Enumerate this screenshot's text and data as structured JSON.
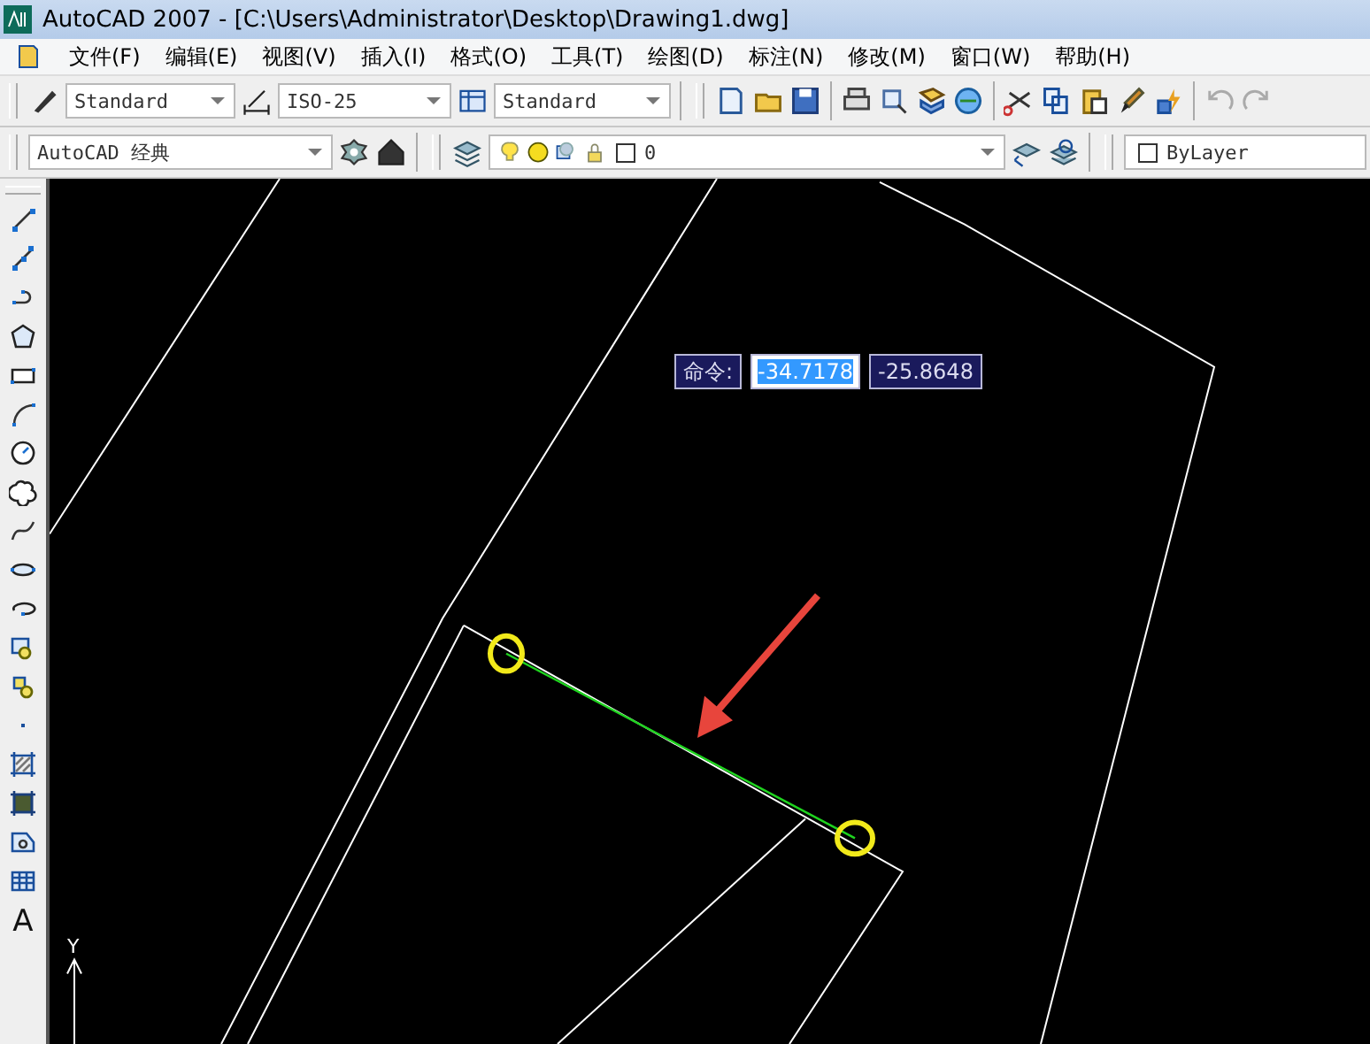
{
  "window": {
    "title": "AutoCAD 2007 - [C:\\Users\\Administrator\\Desktop\\Drawing1.dwg]"
  },
  "menu": [
    "文件(F)",
    "编辑(E)",
    "视图(V)",
    "插入(I)",
    "格式(O)",
    "工具(T)",
    "绘图(D)",
    "标注(N)",
    "修改(M)",
    "窗口(W)",
    "帮助(H)"
  ],
  "styles_toolbar": {
    "text_style": "Standard",
    "dim_style": "ISO-25",
    "table_style": "Standard"
  },
  "workspace": {
    "value": "AutoCAD 经典"
  },
  "layer": {
    "name": "0"
  },
  "color": {
    "value": "ByLayer"
  },
  "draw_toolbar": {
    "text_tool": "A"
  },
  "dynamic_input": {
    "prompt": "命令:",
    "fields": [
      {
        "value": "-34.7178",
        "selected": true
      },
      {
        "value": "-25.8648",
        "selected": false
      }
    ]
  },
  "ucs": {
    "axis": "Y"
  }
}
